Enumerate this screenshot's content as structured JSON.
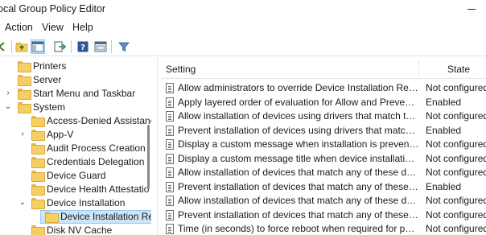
{
  "window": {
    "title": "ocal Group Policy Editor"
  },
  "menu": [
    "Action",
    "View",
    "Help"
  ],
  "toolbar": {
    "icons": [
      "back-icon",
      "up-folder-icon",
      "show-hide-tree-icon",
      "export-list-icon",
      "help-icon",
      "properties-icon",
      "filter-icon"
    ]
  },
  "tree": {
    "items": [
      {
        "label": "Printers",
        "arrow": "",
        "selected": false
      },
      {
        "label": "Server",
        "arrow": "",
        "selected": false
      },
      {
        "label": "Start Menu and Taskbar",
        "arrow": "›",
        "selected": false
      },
      {
        "label": "System",
        "arrow": "⌄",
        "selected": false
      },
      {
        "label": "Access-Denied Assistanc",
        "arrow": "",
        "selected": false
      },
      {
        "label": "App-V",
        "arrow": "›",
        "selected": false
      },
      {
        "label": "Audit Process Creation",
        "arrow": "",
        "selected": false
      },
      {
        "label": "Credentials Delegation",
        "arrow": "",
        "selected": false
      },
      {
        "label": "Device Guard",
        "arrow": "",
        "selected": false
      },
      {
        "label": "Device Health Attestatio",
        "arrow": "",
        "selected": false
      },
      {
        "label": "Device Installation",
        "arrow": "⌄",
        "selected": false
      },
      {
        "label": "Device Installation Re",
        "arrow": "",
        "selected": true
      },
      {
        "label": "Disk NV Cache",
        "arrow": "",
        "selected": false
      }
    ]
  },
  "list": {
    "headers": {
      "setting": "Setting",
      "state": "State"
    },
    "rows": [
      {
        "setting": "Allow administrators to override Device Installation Restricti...",
        "state": "Not configured"
      },
      {
        "setting": "Apply layered order of evaluation for Allow and Prevent devi...",
        "state": "Enabled"
      },
      {
        "setting": "Allow installation of devices using drivers that match these ...",
        "state": "Not configured"
      },
      {
        "setting": "Prevent installation of devices using drivers that match thes...",
        "state": "Enabled"
      },
      {
        "setting": "Display a custom message when installation is prevented by...",
        "state": "Not configured"
      },
      {
        "setting": "Display a custom message title when device installation is pr...",
        "state": "Not configured"
      },
      {
        "setting": "Allow installation of devices that match any of these device ...",
        "state": "Not configured"
      },
      {
        "setting": "Prevent installation of devices that match any of these devic...",
        "state": "Enabled"
      },
      {
        "setting": "Allow installation of devices that match any of these device ...",
        "state": "Not configured"
      },
      {
        "setting": "Prevent installation of devices that match any of these devic...",
        "state": "Not configured"
      },
      {
        "setting": "Time (in seconds) to force reboot when required for policy c...",
        "state": "Not configured"
      }
    ]
  }
}
